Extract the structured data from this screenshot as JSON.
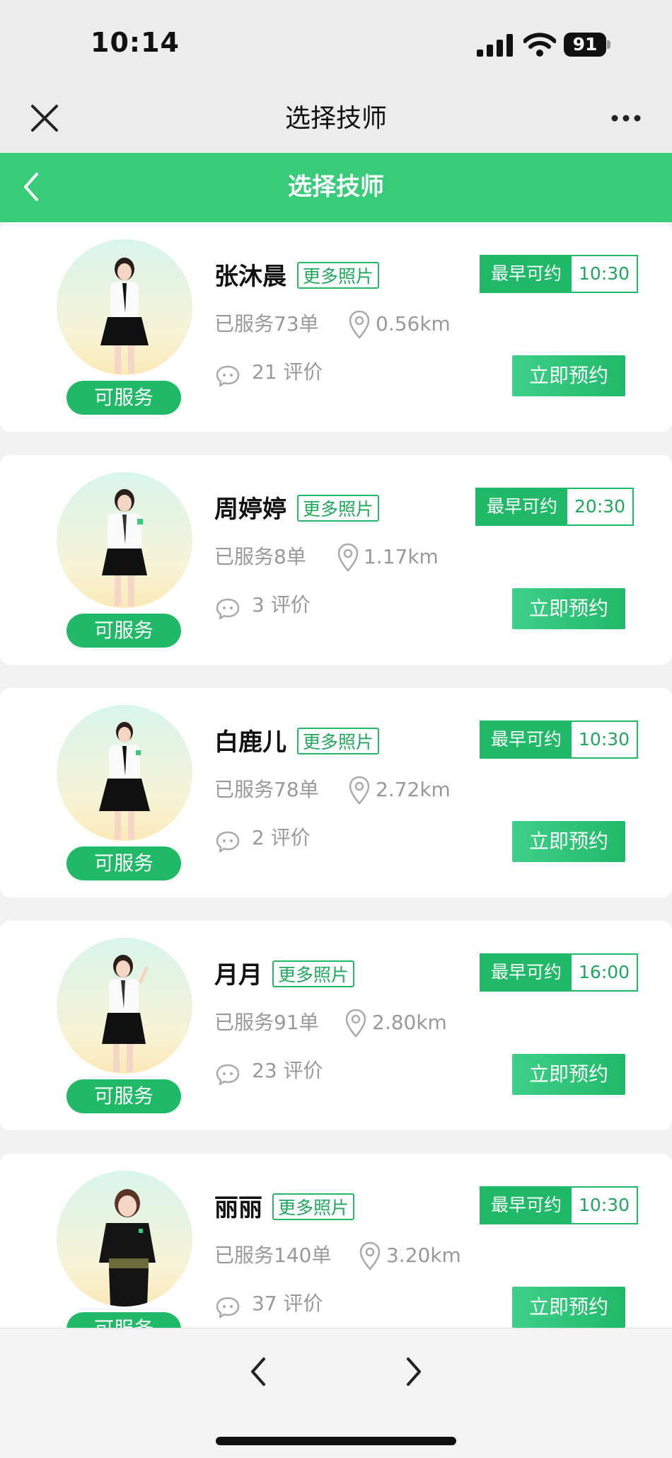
{
  "status_bar": {
    "time": "10:14",
    "battery": "91"
  },
  "nav": {
    "title": "选择技师"
  },
  "header": {
    "title": "选择技师"
  },
  "technicians": [
    {
      "name": "张沐晨",
      "photos_label": "更多照片",
      "slot_label": "最早可约",
      "slot_time": "10:30",
      "served": "已服务73单",
      "distance": "0.56km",
      "reviews": "21 评价",
      "status": "可服务",
      "book_label": "立即预约",
      "outfit": "white"
    },
    {
      "name": "周婷婷",
      "photos_label": "更多照片",
      "slot_label": "最早可约",
      "slot_time": "20:30",
      "served": "已服务8单",
      "distance": "1.17km",
      "reviews": "3 评价",
      "status": "可服务",
      "book_label": "立即预约",
      "outfit": "white"
    },
    {
      "name": "白鹿儿",
      "photos_label": "更多照片",
      "slot_label": "最早可约",
      "slot_time": "10:30",
      "served": "已服务78单",
      "distance": "2.72km",
      "reviews": "2 评价",
      "status": "可服务",
      "book_label": "立即预约",
      "outfit": "white"
    },
    {
      "name": "月月",
      "photos_label": "更多照片",
      "slot_label": "最早可约",
      "slot_time": "16:00",
      "served": "已服务91单",
      "distance": "2.80km",
      "reviews": "23 评价",
      "status": "可服务",
      "book_label": "立即预约",
      "outfit": "white"
    },
    {
      "name": "丽丽",
      "photos_label": "更多照片",
      "slot_label": "最早可约",
      "slot_time": "10:30",
      "served": "已服务140单",
      "distance": "3.20km",
      "reviews": "37 评价",
      "status": "可服务",
      "book_label": "立即预约",
      "outfit": "black"
    }
  ],
  "colors": {
    "accent": "#36cc79",
    "button_green": "#1fb967",
    "muted_text": "#999999"
  },
  "icons": {
    "close": "close-icon",
    "more": "more-dots-icon",
    "back": "chevron-left-icon",
    "location": "location-pin-icon",
    "comment": "chat-bubble-icon",
    "prev": "chevron-left-icon",
    "next": "chevron-right-icon"
  }
}
